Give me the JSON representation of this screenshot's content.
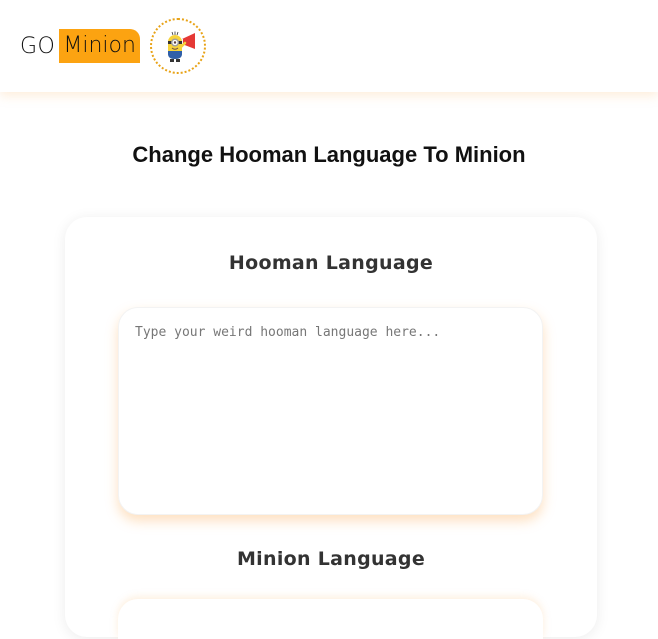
{
  "brand": {
    "go": "GO",
    "minion": "Minion",
    "accent": "#fca311"
  },
  "logo": {
    "icon": "minion-mascot-icon"
  },
  "page": {
    "title": "Change Hooman Language To Minion"
  },
  "translator": {
    "input_label": "Hooman Language",
    "input_placeholder": "Type your weird hooman language here...",
    "input_value": "",
    "output_label": "Minion Language"
  }
}
